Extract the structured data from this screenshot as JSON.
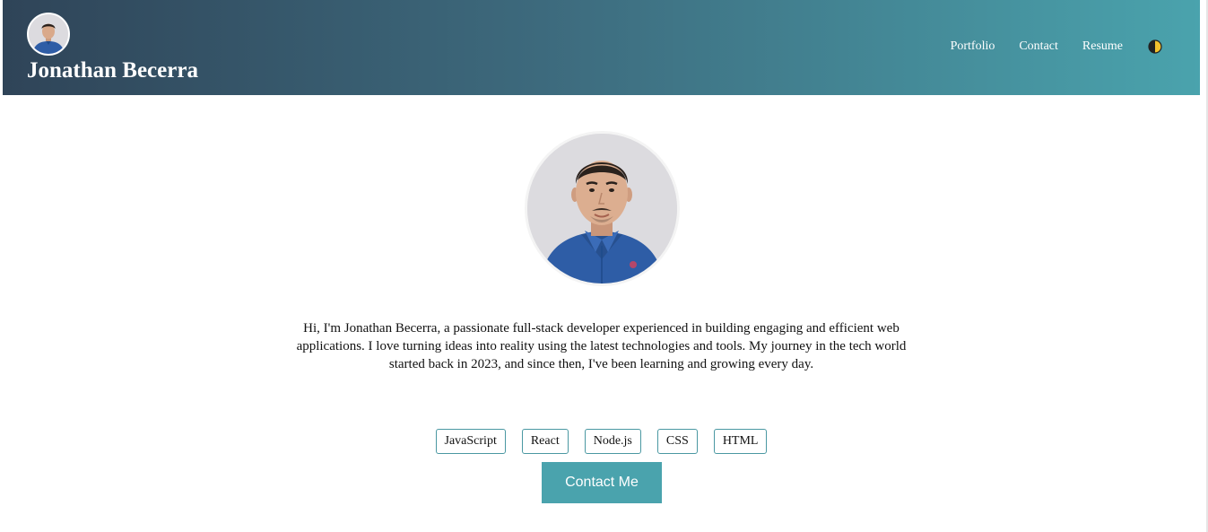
{
  "header": {
    "name": "Jonathan Becerra",
    "nav": {
      "portfolio": "Portfolio",
      "contact": "Contact",
      "resume": "Resume"
    },
    "theme_toggle_icon": "half-circle-theme-icon"
  },
  "main": {
    "bio": "Hi, I'm Jonathan Becerra, a passionate full-stack developer experienced in building engaging and efficient web applications. I love turning ideas into reality using the latest technologies and tools. My journey in the tech world started back in 2023, and since then, I've been learning and growing every day.",
    "skills": [
      "JavaScript",
      "React",
      "Node.js",
      "CSS",
      "HTML"
    ],
    "contact_button": "Contact Me"
  },
  "colors": {
    "header_gradient_start": "#2f4458",
    "header_gradient_end": "#4aa3ad",
    "accent": "#4aa3ad",
    "shirt": "#2e5da6",
    "photo_background": "#dcdbdf"
  }
}
